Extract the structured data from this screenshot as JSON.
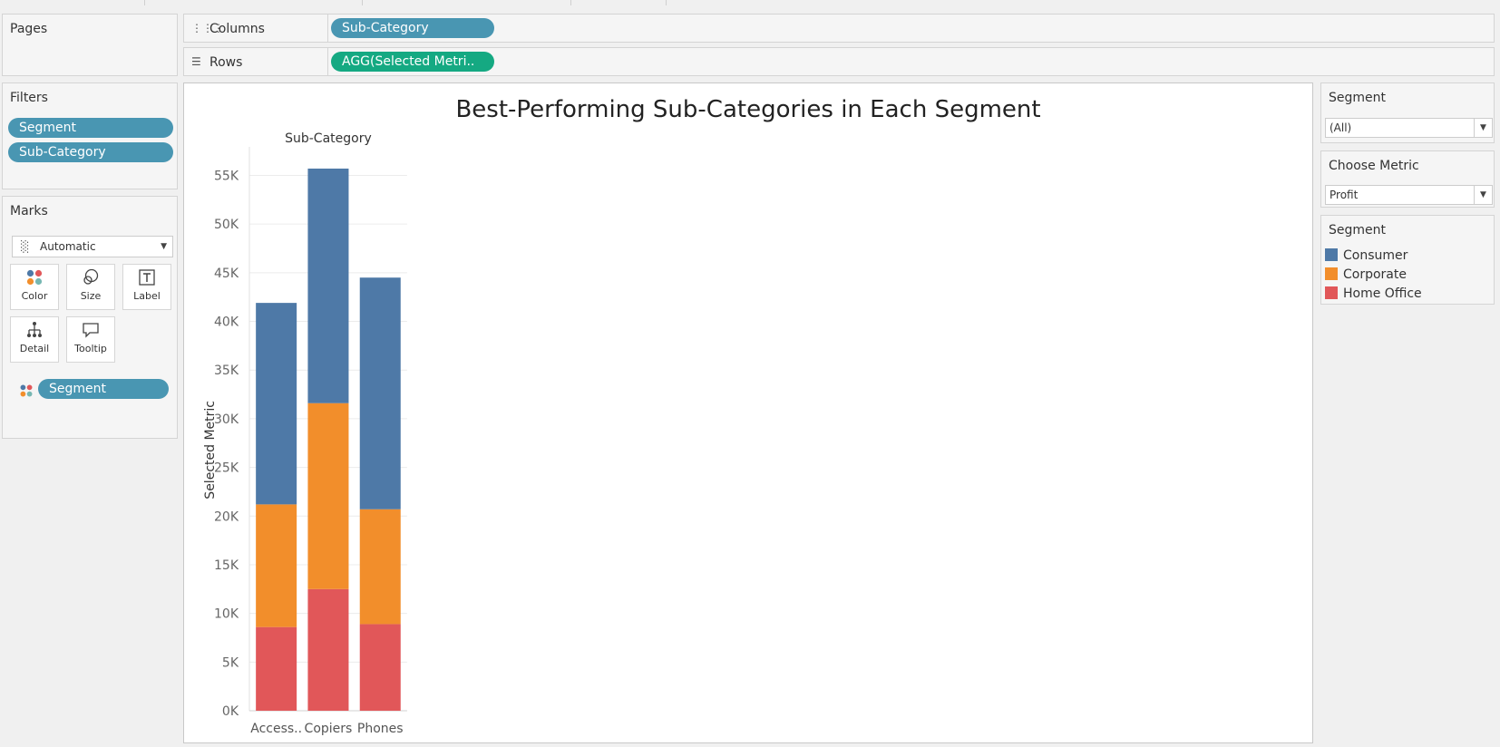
{
  "shelves": {
    "columns_label": "Columns",
    "columns_pill": "Sub-Category",
    "rows_label": "Rows",
    "rows_pill": "AGG(Selected Metri.."
  },
  "pages": {
    "title": "Pages"
  },
  "filters": {
    "title": "Filters",
    "items": [
      "Segment",
      "Sub-Category"
    ]
  },
  "marks": {
    "title": "Marks",
    "type": "Automatic",
    "buttons": [
      "Color",
      "Size",
      "Label",
      "Detail",
      "Tooltip"
    ],
    "color_field": "Segment"
  },
  "right_panel": {
    "segment_filter_title": "Segment",
    "segment_filter_value": "(All)",
    "metric_title": "Choose Metric",
    "metric_value": "Profit",
    "legend_title": "Segment",
    "legend": [
      {
        "name": "Consumer",
        "color": "#4e79a7"
      },
      {
        "name": "Corporate",
        "color": "#f28e2b"
      },
      {
        "name": "Home Office",
        "color": "#e15759"
      }
    ]
  },
  "chart_data": {
    "type": "bar",
    "title": "Best-Performing Sub-Categories in Each Segment",
    "xlabel": "Sub-Category",
    "ylabel": "Selected Metric",
    "stacked": true,
    "categories": [
      "Access..",
      "Copiers",
      "Phones"
    ],
    "series": [
      {
        "name": "Home Office",
        "color": "#e15759",
        "values": [
          8600,
          12500,
          8900
        ]
      },
      {
        "name": "Corporate",
        "color": "#f28e2b",
        "values": [
          12600,
          19100,
          11800
        ]
      },
      {
        "name": "Consumer",
        "color": "#4e79a7",
        "values": [
          20700,
          24100,
          23800
        ]
      }
    ],
    "ylim": [
      0,
      57000
    ],
    "yticks": [
      0,
      5000,
      10000,
      15000,
      20000,
      25000,
      30000,
      35000,
      40000,
      45000,
      50000,
      55000
    ],
    "ytick_labels": [
      "0K",
      "5K",
      "10K",
      "15K",
      "20K",
      "25K",
      "30K",
      "35K",
      "40K",
      "45K",
      "50K",
      "55K"
    ],
    "grid": true
  }
}
